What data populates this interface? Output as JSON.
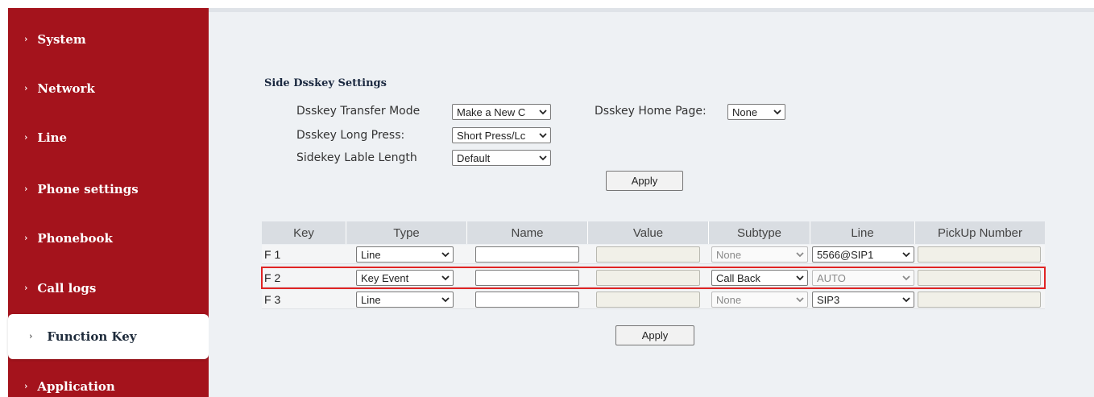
{
  "sidebar": {
    "items": [
      {
        "label": "System",
        "icon": "chevron-right-icon"
      },
      {
        "label": "Network",
        "icon": "chevron-right-icon"
      },
      {
        "label": "Line",
        "icon": "chevron-right-icon"
      },
      {
        "label": "Phone settings",
        "icon": "chevron-right-icon"
      },
      {
        "label": "Phonebook",
        "icon": "chevron-right-icon"
      },
      {
        "label": "Call logs",
        "icon": "chevron-right-icon"
      },
      {
        "label": "Function Key",
        "icon": "chevron-right-icon",
        "active": true
      },
      {
        "label": "Application",
        "icon": "chevron-right-icon"
      }
    ],
    "chevron": "›"
  },
  "settings": {
    "title": "Side Dsskey Settings",
    "transfer_mode_label": "Dsskey Transfer Mode",
    "transfer_mode_value": "Make a New C",
    "long_press_label": "Dsskey Long Press:",
    "long_press_value": "Short Press/Lc",
    "lable_length_label": "Sidekey Lable Length",
    "lable_length_value": "Default",
    "home_page_label": "Dsskey Home Page:",
    "home_page_value": "None",
    "apply_label": "Apply"
  },
  "table": {
    "headers": [
      "Key",
      "Type",
      "Name",
      "Value",
      "Subtype",
      "Line",
      "PickUp Number"
    ],
    "rows": [
      {
        "key": "F 1",
        "type": "Line",
        "name": "",
        "value": "",
        "subtype": "None",
        "subtype_disabled": true,
        "line": "5566@SIP1",
        "line_disabled": false,
        "pickup": ""
      },
      {
        "key": "F 2",
        "type": "Key Event",
        "name": "",
        "value": "",
        "subtype": "Call Back",
        "subtype_disabled": false,
        "line": "AUTO",
        "line_disabled": true,
        "pickup": "",
        "highlighted": true
      },
      {
        "key": "F 3",
        "type": "Line",
        "name": "",
        "value": "",
        "subtype": "None",
        "subtype_disabled": true,
        "line": "SIP3",
        "line_disabled": false,
        "pickup": ""
      }
    ],
    "apply_label": "Apply"
  },
  "colors": {
    "sidebar_bg": "#a4131c",
    "content_bg": "#eef1f4",
    "highlight_border": "#e02424"
  }
}
